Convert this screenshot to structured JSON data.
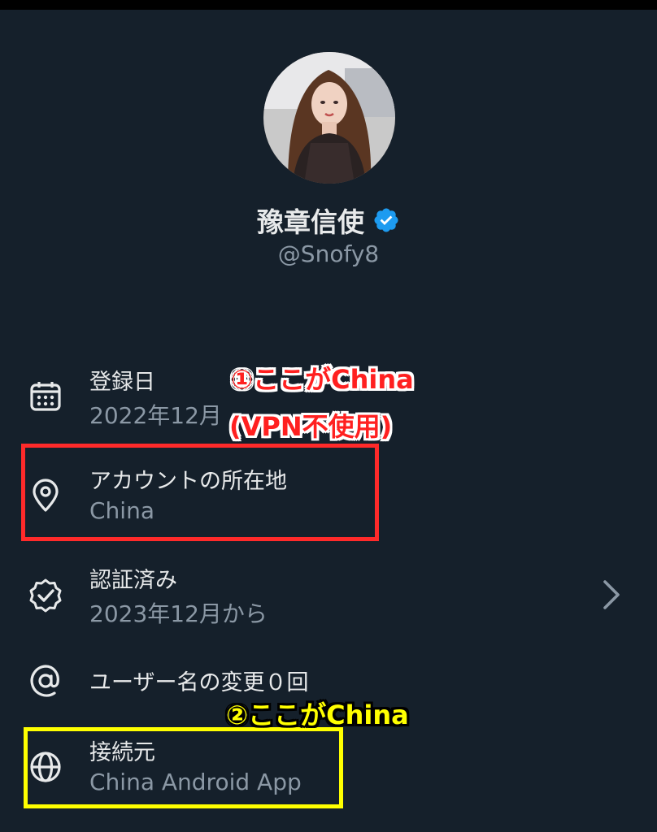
{
  "profile": {
    "name": "豫章信使",
    "handle": "@Snofy8",
    "avatar_icon": "profile-photo",
    "verified_icon": "verified-badge-icon",
    "verified_color": "#1d9bf0"
  },
  "rows": [
    {
      "icon": "calendar-icon",
      "title": "登録日",
      "value": "2022年12月"
    },
    {
      "icon": "location-pin-icon",
      "title": "アカウントの所在地",
      "value": "China"
    },
    {
      "icon": "verified-check-icon",
      "title": "認証済み",
      "value": "2023年12月から",
      "chevron": "chevron-right-icon"
    },
    {
      "icon": "at-sign-icon",
      "title": "ユーザー名の変更０回"
    },
    {
      "icon": "globe-icon",
      "title": "接続元",
      "value": "China Android App"
    }
  ],
  "annotations": {
    "red_line1": "①ここがChina",
    "red_line2": "(VPN不使用)",
    "yellow": "②ここがChina",
    "red_color": "#ff2020",
    "yellow_color": "#ffff00"
  },
  "colors": {
    "background": "#15202b",
    "primary_text": "#e7e9ea",
    "secondary_text": "#8b98a5"
  }
}
